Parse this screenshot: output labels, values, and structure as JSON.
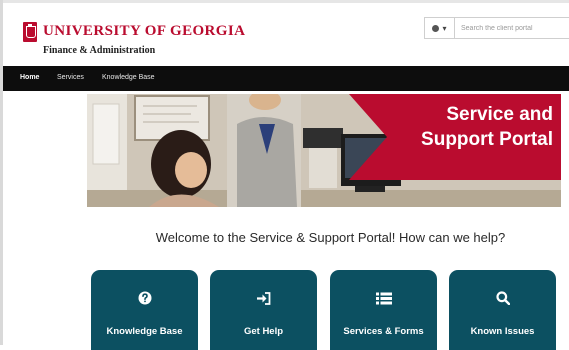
{
  "brand": {
    "title": "UNIVERSITY OF GEORGIA",
    "subtitle": "Finance & Administration"
  },
  "header": {
    "language_caret": "▾",
    "search_placeholder": "Search the client portal"
  },
  "nav": {
    "items": [
      {
        "label": "Home",
        "active": true
      },
      {
        "label": "Services",
        "active": false
      },
      {
        "label": "Knowledge Base",
        "active": false
      }
    ]
  },
  "hero": {
    "title_line1": "Service and",
    "title_line2": "Support Portal",
    "banner_color": "#ba0c2f"
  },
  "welcome": {
    "text": "Welcome to the Service & Support Portal! How can we help?"
  },
  "tiles": [
    {
      "label": "Knowledge Base",
      "icon": "question-circle-icon"
    },
    {
      "label": "Get Help",
      "icon": "sign-in-icon"
    },
    {
      "label": "Services & Forms",
      "icon": "list-icon"
    },
    {
      "label": "Known Issues",
      "icon": "search-icon"
    }
  ],
  "colors": {
    "accent_red": "#ba0c2f",
    "nav_black": "#0d0d0d",
    "tile_teal": "#0c5061"
  }
}
